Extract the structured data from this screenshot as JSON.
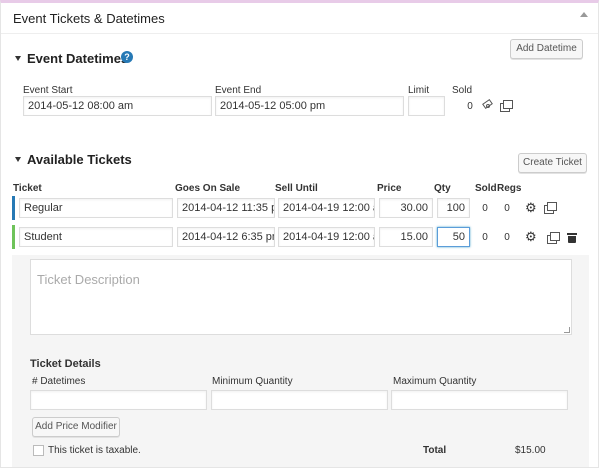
{
  "header": {
    "title": "Event Tickets & Datetimes"
  },
  "datetimes": {
    "section_title": "Event Datetimes",
    "help_glyph": "?",
    "add_button": "Add Datetime",
    "columns": {
      "start": "Event Start",
      "end": "Event End",
      "limit": "Limit",
      "sold": "Sold"
    },
    "row": {
      "start": "2014-05-12 08:00 am",
      "end": "2014-05-12 05:00 pm",
      "limit": "",
      "sold": "0"
    }
  },
  "tickets": {
    "section_title": "Available Tickets",
    "create_button": "Create Ticket",
    "columns": {
      "ticket": "Ticket",
      "goes_on_sale": "Goes On Sale",
      "sell_until": "Sell Until",
      "price": "Price",
      "qty": "Qty",
      "sold": "Sold",
      "regs": "Regs"
    },
    "rows": [
      {
        "name": "Regular",
        "goes_on_sale": "2014-04-12  11:35 p",
        "sell_until": "2014-04-19  12:00 a",
        "price": "30.00",
        "qty": "100",
        "sold": "0",
        "regs": "0",
        "accent": "#2679b5"
      },
      {
        "name": "Student",
        "goes_on_sale": "2014-04-12  6:35 pm",
        "sell_until": "2014-04-19  12:00 a",
        "price": "15.00",
        "qty": "50",
        "sold": "0",
        "regs": "0",
        "accent": "#6ec35a"
      }
    ]
  },
  "details": {
    "description_placeholder": "Ticket Description",
    "ticket_details_title": "Ticket Details",
    "num_datetimes_label": "# Datetimes",
    "min_qty_label": "Minimum Quantity",
    "max_qty_label": "Maximum Quantity",
    "add_price_modifier": "Add Price Modifier",
    "taxable_label": "This ticket is taxable.",
    "total_label": "Total",
    "total_value": "$15.00"
  }
}
